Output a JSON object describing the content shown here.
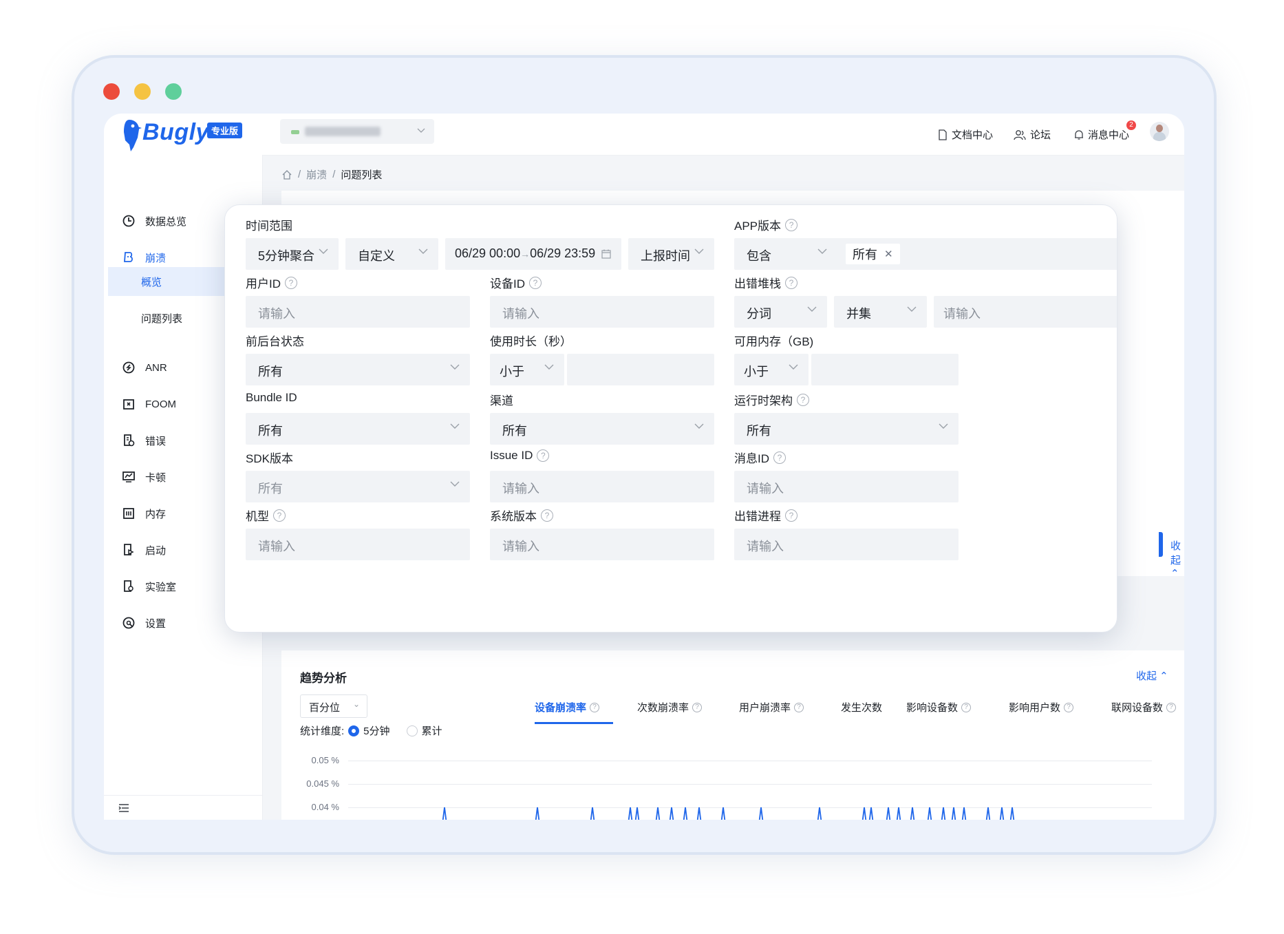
{
  "brand": {
    "name": "Bugly",
    "edition": "专业版"
  },
  "header": {
    "doc_center": "文档中心",
    "forum": "论坛",
    "message_center": "消息中心",
    "message_badge": "2"
  },
  "sidebar": {
    "items": [
      {
        "label": "数据总览",
        "icon": "pie-chart-icon"
      },
      {
        "label": "崩溃",
        "icon": "crash-icon"
      },
      {
        "label": "ANR",
        "icon": "anr-icon"
      },
      {
        "label": "FOOM",
        "icon": "foom-icon"
      },
      {
        "label": "错误",
        "icon": "error-icon"
      },
      {
        "label": "卡顿",
        "icon": "lag-icon"
      },
      {
        "label": "内存",
        "icon": "memory-icon"
      },
      {
        "label": "启动",
        "icon": "launch-icon"
      },
      {
        "label": "实验室",
        "icon": "lab-icon"
      },
      {
        "label": "设置",
        "icon": "settings-icon"
      }
    ],
    "sub_items": [
      {
        "label": "概览"
      },
      {
        "label": "问题列表"
      }
    ]
  },
  "breadcrumb": {
    "level1": "崩溃",
    "current": "问题列表",
    "separator": "/"
  },
  "collapse_label": "收起",
  "filters": {
    "time_range": {
      "label": "时间范围",
      "aggregation": "5分钟聚合",
      "mode": "自定义",
      "start": "06/29 00:00",
      "end": "06/29 23:59",
      "arrow": "→",
      "time_field": "上报时间"
    },
    "app_version": {
      "label": "APP版本",
      "operator": "包含",
      "chip": "所有"
    },
    "user_id": {
      "label": "用户ID",
      "placeholder": "请输入"
    },
    "device_id": {
      "label": "设备ID",
      "placeholder": "请输入"
    },
    "stack": {
      "label": "出错堆栈",
      "mode": "分词",
      "logic": "并集",
      "placeholder": "请输入"
    },
    "foreground": {
      "label": "前后台状态",
      "value": "所有"
    },
    "duration": {
      "label": "使用时长（秒）",
      "operator": "小于"
    },
    "memory": {
      "label": "可用内存（GB)",
      "operator": "小于"
    },
    "bundle_id": {
      "label": "Bundle ID",
      "value": "所有"
    },
    "channel": {
      "label": "渠道",
      "value": "所有"
    },
    "arch": {
      "label": "运行时架构",
      "value": "所有"
    },
    "sdk_version": {
      "label": "SDK版本",
      "value": "所有"
    },
    "issue_id": {
      "label": "Issue ID",
      "placeholder": "请输入"
    },
    "message_id": {
      "label": "消息ID",
      "placeholder": "请输入"
    },
    "model": {
      "label": "机型",
      "placeholder": "请输入"
    },
    "os_version": {
      "label": "系统版本",
      "placeholder": "请输入"
    },
    "process": {
      "label": "出错进程",
      "placeholder": "请输入"
    }
  },
  "trend": {
    "title": "趋势分析",
    "collapse": "收起",
    "unit_select": "百分位",
    "dimension_label": "统计维度:",
    "radio_5min": "5分钟",
    "radio_cumulative": "累计",
    "tabs": [
      "设备崩溃率",
      "次数崩溃率",
      "用户崩溃率",
      "发生次数",
      "影响设备数",
      "影响用户数",
      "联网设备数"
    ],
    "y_ticks": [
      "0.05 %",
      "0.045 %",
      "0.04 %"
    ]
  },
  "colors": {
    "accent": "#1f66ea",
    "dot_red": "#ec4c3c",
    "dot_yellow": "#f5c342",
    "dot_green": "#5fcf9b",
    "badge": "#f04848"
  }
}
